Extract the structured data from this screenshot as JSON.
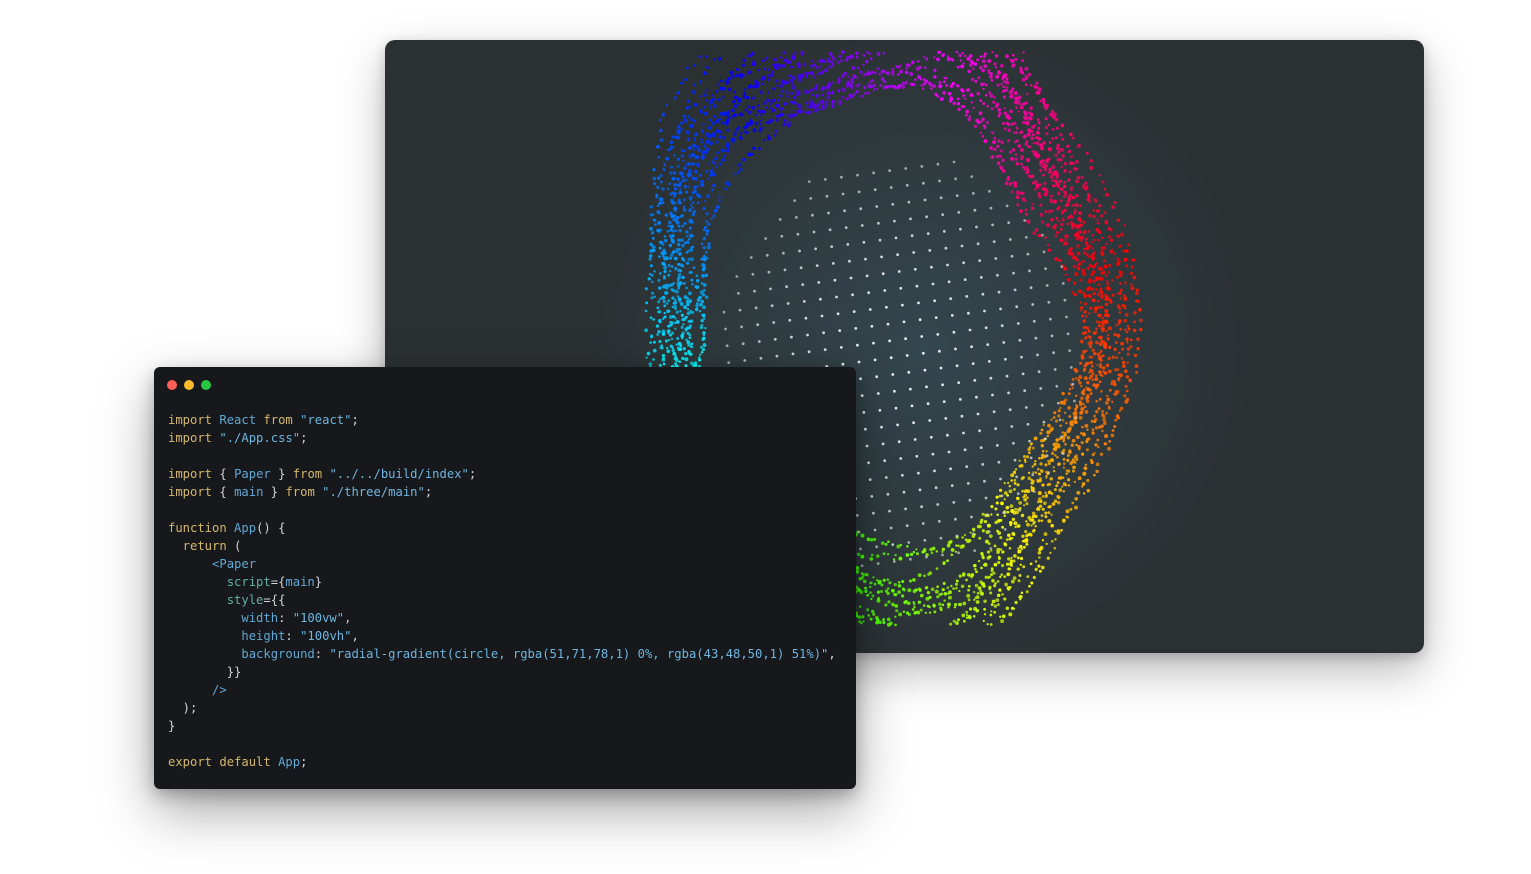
{
  "code_window": {
    "lines": [
      [
        {
          "t": "import ",
          "c": "kw"
        },
        {
          "t": "React ",
          "c": "id"
        },
        {
          "t": "from ",
          "c": "kw"
        },
        {
          "t": "\"react\"",
          "c": "str"
        },
        {
          "t": ";",
          "c": "p"
        }
      ],
      [
        {
          "t": "import ",
          "c": "kw"
        },
        {
          "t": "\"./App.css\"",
          "c": "str"
        },
        {
          "t": ";",
          "c": "p"
        }
      ],
      [],
      [
        {
          "t": "import ",
          "c": "kw"
        },
        {
          "t": "{ ",
          "c": "p"
        },
        {
          "t": "Paper",
          "c": "id"
        },
        {
          "t": " } ",
          "c": "p"
        },
        {
          "t": "from ",
          "c": "kw"
        },
        {
          "t": "\"../../build/index\"",
          "c": "str"
        },
        {
          "t": ";",
          "c": "p"
        }
      ],
      [
        {
          "t": "import ",
          "c": "kw"
        },
        {
          "t": "{ ",
          "c": "p"
        },
        {
          "t": "main",
          "c": "id"
        },
        {
          "t": " } ",
          "c": "p"
        },
        {
          "t": "from ",
          "c": "kw"
        },
        {
          "t": "\"./three/main\"",
          "c": "str"
        },
        {
          "t": ";",
          "c": "p"
        }
      ],
      [],
      [
        {
          "t": "function ",
          "c": "kw"
        },
        {
          "t": "App",
          "c": "id"
        },
        {
          "t": "() {",
          "c": "p"
        }
      ],
      [
        {
          "t": "  return ",
          "c": "kw"
        },
        {
          "t": "(",
          "c": "p"
        }
      ],
      [
        {
          "t": "      <Paper",
          "c": "tag"
        }
      ],
      [
        {
          "t": "        script",
          "c": "attr"
        },
        {
          "t": "={",
          "c": "p"
        },
        {
          "t": "main",
          "c": "id"
        },
        {
          "t": "}",
          "c": "p"
        }
      ],
      [
        {
          "t": "        style",
          "c": "attr"
        },
        {
          "t": "={{",
          "c": "p"
        }
      ],
      [
        {
          "t": "          width",
          "c": "id"
        },
        {
          "t": ": ",
          "c": "p"
        },
        {
          "t": "\"100vw\"",
          "c": "str"
        },
        {
          "t": ",",
          "c": "p"
        }
      ],
      [
        {
          "t": "          height",
          "c": "id"
        },
        {
          "t": ": ",
          "c": "p"
        },
        {
          "t": "\"100vh\"",
          "c": "str"
        },
        {
          "t": ",",
          "c": "p"
        }
      ],
      [
        {
          "t": "          background",
          "c": "id"
        },
        {
          "t": ": ",
          "c": "p"
        },
        {
          "t": "\"radial-gradient(circle, rgba(51,71,78,1) 0%, rgba(43,48,50,1) 51%)\"",
          "c": "str"
        },
        {
          "t": ",",
          "c": "p"
        }
      ],
      [
        {
          "t": "        }}",
          "c": "p"
        }
      ],
      [
        {
          "t": "      />",
          "c": "tag"
        }
      ],
      [
        {
          "t": "  );",
          "c": "p"
        }
      ],
      [
        {
          "t": "}",
          "c": "p"
        }
      ],
      [],
      [
        {
          "t": "export ",
          "c": "kw"
        },
        {
          "t": "default ",
          "c": "kw"
        },
        {
          "t": "App",
          "c": "id"
        },
        {
          "t": ";",
          "c": "p"
        }
      ]
    ]
  },
  "colors": {
    "traffic_close": "#ff5f57",
    "traffic_minimize": "#febc2e",
    "traffic_zoom": "#28c840",
    "preview_bg_center": "#33474e",
    "preview_bg_edge": "#2b3032",
    "code_bg": "#17181b"
  }
}
